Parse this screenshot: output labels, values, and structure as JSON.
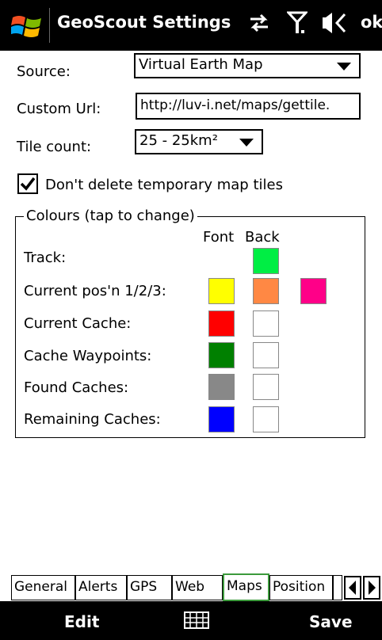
{
  "title_bar": {
    "title": "GeoScout Settings",
    "ok_label": "ok",
    "icons": [
      "windows-start-icon",
      "connectivity-icon",
      "signal-icon",
      "volume-icon"
    ]
  },
  "form": {
    "source_label": "Source:",
    "source_value": "Virtual Earth Map",
    "custom_url_label": "Custom Url:",
    "custom_url_value": "http://luv-i.net/maps/gettile.",
    "tile_count_label": "Tile count:",
    "tile_count_value": "25 - 25km²",
    "keep_tiles_label": "Don't delete temporary map tiles",
    "keep_tiles_checked": true
  },
  "colours": {
    "group_label": "Colours (tap to change)",
    "font_header": "Font",
    "back_header": "Back",
    "rows": [
      {
        "label": "Track:",
        "colors": [
          "#00ee44"
        ]
      },
      {
        "label": "Current pos'n 1/2/3:",
        "colors": [
          "#ffff00",
          "#ff8844",
          "#ff0088"
        ]
      },
      {
        "label": "Current Cache:",
        "colors": [
          "#ff0000",
          "#ffffff"
        ]
      },
      {
        "label": "Cache Waypoints:",
        "colors": [
          "#008000",
          "#ffffff"
        ]
      },
      {
        "label": "Found Caches:",
        "colors": [
          "#888888",
          "#ffffff"
        ]
      },
      {
        "label": "Remaining Caches:",
        "colors": [
          "#0000ff",
          "#ffffff"
        ]
      }
    ]
  },
  "tabs": {
    "items": [
      "General",
      "Alerts",
      "GPS",
      "Web",
      "Maps",
      "Position"
    ],
    "active": "Maps"
  },
  "bottom_bar": {
    "left_softkey": "Edit",
    "right_softkey": "Save"
  }
}
